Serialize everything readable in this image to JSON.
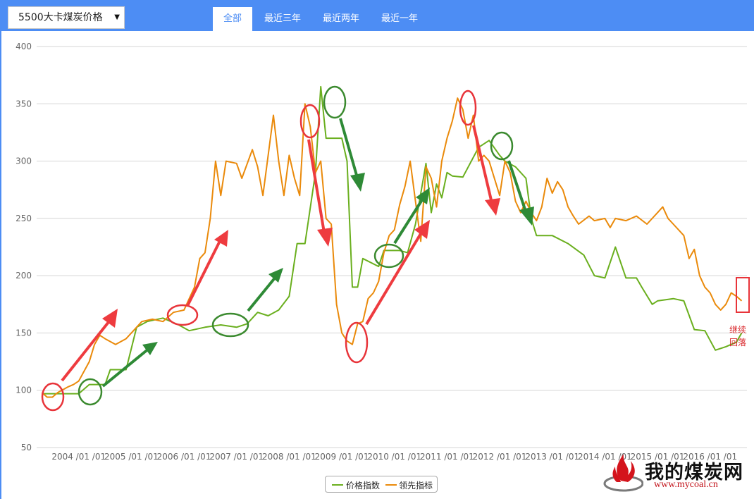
{
  "header": {
    "select_value": "5500大卡煤炭价格",
    "tabs": [
      {
        "label": "全部",
        "active": true
      },
      {
        "label": "最近三年",
        "active": false
      },
      {
        "label": "最近两年",
        "active": false
      },
      {
        "label": "最近一年",
        "active": false
      }
    ]
  },
  "legend": {
    "items": [
      {
        "label": "价格指数",
        "color": "#6aaf1e"
      },
      {
        "label": "领先指标",
        "color": "#ea8a0b"
      }
    ]
  },
  "annotation": {
    "line1": "继续",
    "line2": "回落",
    "color": "#d9262a"
  },
  "logo": {
    "text": "我的煤炭网",
    "url": "www.mycoal.cn"
  },
  "chart_data": {
    "type": "line",
    "ylim": [
      50,
      400
    ],
    "yticks": [
      50,
      100,
      150,
      200,
      250,
      300,
      350,
      400
    ],
    "xlim": [
      2003.2,
      2016.7
    ],
    "xticks": [
      {
        "x": 2004.0,
        "label": "2004 /01 /01"
      },
      {
        "x": 2005.0,
        "label": "2005 /01 /01"
      },
      {
        "x": 2006.0,
        "label": "2006 /01 /01"
      },
      {
        "x": 2007.0,
        "label": "2007 /01 /01"
      },
      {
        "x": 2008.0,
        "label": "2008 /01 /01"
      },
      {
        "x": 2009.0,
        "label": "2009 /01 /01"
      },
      {
        "x": 2010.0,
        "label": "2010 /01 /01"
      },
      {
        "x": 2011.0,
        "label": "2011 /01 /01"
      },
      {
        "x": 2012.0,
        "label": "2012 /01 /01"
      },
      {
        "x": 2013.0,
        "label": "2013 /01 /01"
      },
      {
        "x": 2014.0,
        "label": "2014 /01 /01"
      },
      {
        "x": 2015.0,
        "label": "2015 /01 /01"
      },
      {
        "x": 2016.0,
        "label": "2016 /01 /01"
      }
    ],
    "grid": true,
    "legend_position": "bottom",
    "series": [
      {
        "name": "价格指数",
        "color": "#6aaf1e",
        "points": [
          [
            2003.3,
            97
          ],
          [
            2003.6,
            97
          ],
          [
            2004.0,
            97
          ],
          [
            2004.2,
            105
          ],
          [
            2004.5,
            105
          ],
          [
            2004.6,
            118
          ],
          [
            2004.9,
            118
          ],
          [
            2005.1,
            155
          ],
          [
            2005.3,
            160
          ],
          [
            2005.6,
            163
          ],
          [
            2005.9,
            157
          ],
          [
            2006.1,
            152
          ],
          [
            2006.4,
            155
          ],
          [
            2006.7,
            157
          ],
          [
            2007.0,
            155
          ],
          [
            2007.2,
            158
          ],
          [
            2007.4,
            168
          ],
          [
            2007.6,
            165
          ],
          [
            2007.8,
            170
          ],
          [
            2008.0,
            182
          ],
          [
            2008.15,
            228
          ],
          [
            2008.3,
            228
          ],
          [
            2008.5,
            290
          ],
          [
            2008.6,
            365
          ],
          [
            2008.7,
            320
          ],
          [
            2009.0,
            320
          ],
          [
            2009.1,
            300
          ],
          [
            2009.2,
            190
          ],
          [
            2009.3,
            190
          ],
          [
            2009.4,
            215
          ],
          [
            2009.7,
            208
          ],
          [
            2009.8,
            222
          ],
          [
            2010.1,
            222
          ],
          [
            2010.25,
            220
          ],
          [
            2010.4,
            245
          ],
          [
            2010.6,
            298
          ],
          [
            2010.7,
            255
          ],
          [
            2010.8,
            280
          ],
          [
            2010.9,
            268
          ],
          [
            2011.0,
            290
          ],
          [
            2011.1,
            287
          ],
          [
            2011.3,
            286
          ],
          [
            2011.6,
            312
          ],
          [
            2011.8,
            318
          ],
          [
            2012.0,
            305
          ],
          [
            2012.1,
            300
          ],
          [
            2012.3,
            295
          ],
          [
            2012.5,
            285
          ],
          [
            2012.6,
            250
          ],
          [
            2012.7,
            235
          ],
          [
            2013.0,
            235
          ],
          [
            2013.3,
            228
          ],
          [
            2013.6,
            218
          ],
          [
            2013.8,
            200
          ],
          [
            2014.0,
            198
          ],
          [
            2014.2,
            225
          ],
          [
            2014.4,
            198
          ],
          [
            2014.6,
            198
          ],
          [
            2014.7,
            190
          ],
          [
            2014.9,
            175
          ],
          [
            2015.0,
            178
          ],
          [
            2015.3,
            180
          ],
          [
            2015.5,
            178
          ],
          [
            2015.7,
            153
          ],
          [
            2015.9,
            152
          ],
          [
            2016.1,
            135
          ],
          [
            2016.3,
            138
          ],
          [
            2016.5,
            142
          ],
          [
            2016.6,
            150
          ]
        ]
      },
      {
        "name": "领先指标",
        "color": "#ea8a0b",
        "points": [
          [
            2003.3,
            98
          ],
          [
            2003.4,
            94
          ],
          [
            2003.5,
            94
          ],
          [
            2003.6,
            98
          ],
          [
            2003.8,
            103
          ],
          [
            2003.9,
            105
          ],
          [
            2004.0,
            108
          ],
          [
            2004.2,
            125
          ],
          [
            2004.3,
            140
          ],
          [
            2004.4,
            148
          ],
          [
            2004.5,
            145
          ],
          [
            2004.7,
            140
          ],
          [
            2004.9,
            145
          ],
          [
            2005.0,
            150
          ],
          [
            2005.2,
            160
          ],
          [
            2005.4,
            162
          ],
          [
            2005.6,
            160
          ],
          [
            2005.8,
            168
          ],
          [
            2006.0,
            170
          ],
          [
            2006.2,
            190
          ],
          [
            2006.3,
            215
          ],
          [
            2006.4,
            220
          ],
          [
            2006.5,
            250
          ],
          [
            2006.6,
            300
          ],
          [
            2006.7,
            270
          ],
          [
            2006.8,
            300
          ],
          [
            2007.0,
            298
          ],
          [
            2007.1,
            285
          ],
          [
            2007.3,
            310
          ],
          [
            2007.4,
            295
          ],
          [
            2007.5,
            270
          ],
          [
            2007.7,
            340
          ],
          [
            2007.8,
            300
          ],
          [
            2007.9,
            270
          ],
          [
            2008.0,
            305
          ],
          [
            2008.1,
            285
          ],
          [
            2008.2,
            270
          ],
          [
            2008.3,
            350
          ],
          [
            2008.4,
            330
          ],
          [
            2008.5,
            290
          ],
          [
            2008.6,
            300
          ],
          [
            2008.7,
            250
          ],
          [
            2008.8,
            245
          ],
          [
            2008.9,
            175
          ],
          [
            2009.0,
            150
          ],
          [
            2009.1,
            143
          ],
          [
            2009.2,
            140
          ],
          [
            2009.3,
            158
          ],
          [
            2009.4,
            160
          ],
          [
            2009.5,
            180
          ],
          [
            2009.6,
            185
          ],
          [
            2009.7,
            195
          ],
          [
            2009.8,
            220
          ],
          [
            2009.9,
            235
          ],
          [
            2010.0,
            240
          ],
          [
            2010.1,
            262
          ],
          [
            2010.2,
            278
          ],
          [
            2010.3,
            300
          ],
          [
            2010.4,
            265
          ],
          [
            2010.5,
            230
          ],
          [
            2010.6,
            295
          ],
          [
            2010.7,
            285
          ],
          [
            2010.8,
            260
          ],
          [
            2010.9,
            300
          ],
          [
            2011.0,
            320
          ],
          [
            2011.1,
            335
          ],
          [
            2011.2,
            355
          ],
          [
            2011.3,
            345
          ],
          [
            2011.4,
            320
          ],
          [
            2011.5,
            340
          ],
          [
            2011.6,
            300
          ],
          [
            2011.7,
            305
          ],
          [
            2011.8,
            300
          ],
          [
            2011.9,
            285
          ],
          [
            2012.0,
            270
          ],
          [
            2012.1,
            300
          ],
          [
            2012.2,
            290
          ],
          [
            2012.3,
            265
          ],
          [
            2012.4,
            255
          ],
          [
            2012.5,
            265
          ],
          [
            2012.6,
            255
          ],
          [
            2012.7,
            248
          ],
          [
            2012.8,
            260
          ],
          [
            2012.9,
            285
          ],
          [
            2013.0,
            272
          ],
          [
            2013.1,
            282
          ],
          [
            2013.2,
            275
          ],
          [
            2013.3,
            260
          ],
          [
            2013.4,
            252
          ],
          [
            2013.5,
            245
          ],
          [
            2013.7,
            252
          ],
          [
            2013.8,
            248
          ],
          [
            2014.0,
            250
          ],
          [
            2014.1,
            242
          ],
          [
            2014.2,
            250
          ],
          [
            2014.4,
            248
          ],
          [
            2014.6,
            252
          ],
          [
            2014.8,
            245
          ],
          [
            2015.0,
            255
          ],
          [
            2015.1,
            260
          ],
          [
            2015.2,
            250
          ],
          [
            2015.3,
            245
          ],
          [
            2015.5,
            235
          ],
          [
            2015.6,
            215
          ],
          [
            2015.7,
            223
          ],
          [
            2015.8,
            200
          ],
          [
            2015.9,
            190
          ],
          [
            2016.0,
            185
          ],
          [
            2016.1,
            175
          ],
          [
            2016.2,
            170
          ],
          [
            2016.3,
            175
          ],
          [
            2016.4,
            185
          ],
          [
            2016.5,
            182
          ],
          [
            2016.6,
            178
          ]
        ]
      }
    ]
  }
}
